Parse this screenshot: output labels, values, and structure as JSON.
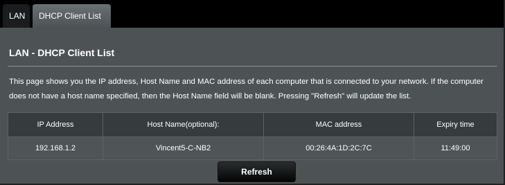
{
  "tabs": [
    {
      "label": "LAN"
    },
    {
      "label": "DHCP Client List"
    }
  ],
  "page_title": "LAN - DHCP Client List",
  "description": "This page shows you the IP address, Host Name and MAC address of each computer that is connected to your network. If the computer does not have a host name specified, then the Host Name field will be blank. Pressing \"Refresh\" will update the list.",
  "table": {
    "headers": [
      "IP Address",
      "Host Name(optional):",
      "MAC address",
      "Expiry time"
    ],
    "rows": [
      [
        "192.168.1.2",
        "Vincent5-C-NB2",
        "00:26:4A:1D:2C:7C",
        "11:49:00"
      ]
    ]
  },
  "refresh_label": "Refresh"
}
